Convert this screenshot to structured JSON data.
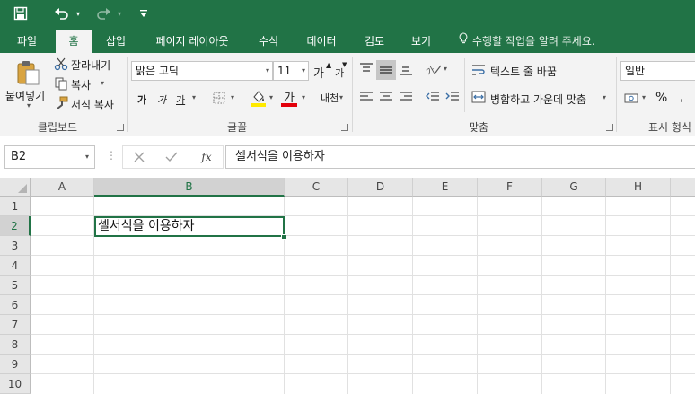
{
  "quick_access": {
    "save_icon": "save-icon",
    "undo_icon": "undo-icon",
    "redo_icon": "redo-icon",
    "customize_icon": "customize-icon"
  },
  "tabs": [
    {
      "label": "파일"
    },
    {
      "label": "홈"
    },
    {
      "label": "삽입"
    },
    {
      "label": "페이지 레이아웃"
    },
    {
      "label": "수식"
    },
    {
      "label": "데이터"
    },
    {
      "label": "검토"
    },
    {
      "label": "보기"
    }
  ],
  "tell_me": "수행할 작업을 알려 주세요.",
  "ribbon": {
    "clipboard": {
      "paste": "붙여넣기",
      "cut": "잘라내기",
      "copy": "복사",
      "format_painter": "서식 복사",
      "label": "클립보드"
    },
    "font": {
      "name": "맑은 고딕",
      "size": "11",
      "grow": "가",
      "shrink": "가",
      "bold": "가",
      "italic": "가",
      "underline": "가",
      "font_color_letter": "가",
      "phonetic": "내천",
      "label": "글꼴"
    },
    "alignment": {
      "wrap_text": "텍스트 줄 바꿈",
      "merge_center": "병합하고 가운데 맞춤",
      "label": "맞춤"
    },
    "number": {
      "format": "일반",
      "percent": "%",
      "label": "표시 형식"
    }
  },
  "formula_bar": {
    "name_box": "B2",
    "fx": "fx",
    "content": "셀서식을 이용하자"
  },
  "grid": {
    "columns": [
      "A",
      "B",
      "C",
      "D",
      "E",
      "F",
      "G",
      "H"
    ],
    "rows": [
      "1",
      "2",
      "3",
      "4",
      "5",
      "6",
      "7",
      "8",
      "9",
      "10"
    ],
    "selected_cell_text": "셀서식을 이용하자"
  },
  "colors": {
    "accent": "#217346",
    "ribbon_bg": "#f3f3f3",
    "header_bg": "#e6e6e6"
  }
}
